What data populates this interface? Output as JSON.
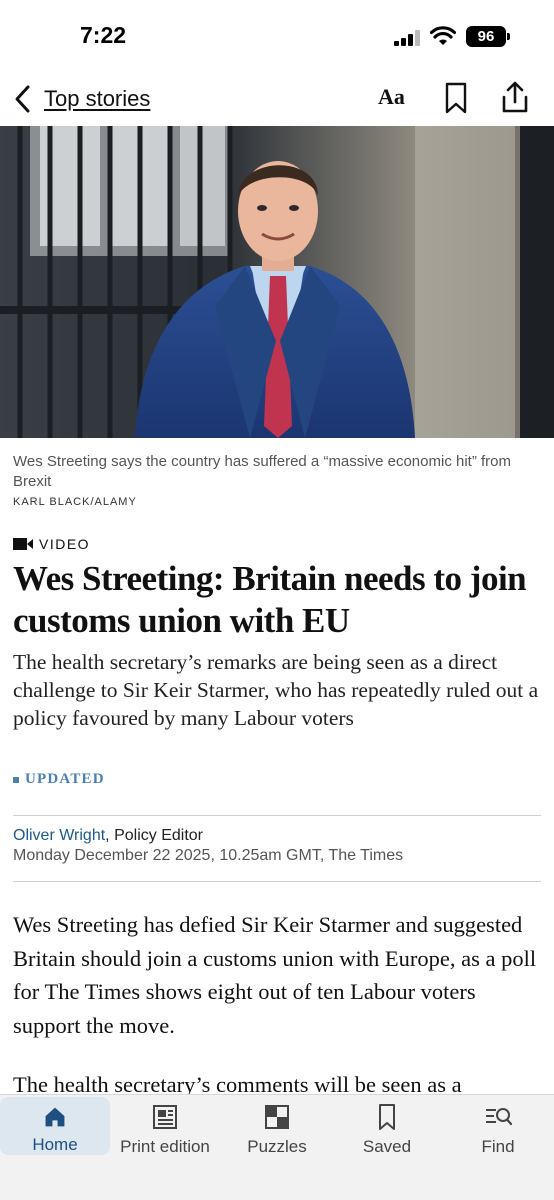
{
  "status_bar": {
    "time": "7:22",
    "battery": "96"
  },
  "nav": {
    "back_label": "Top stories",
    "text_size_label": "Aa",
    "icons": [
      "chevron-left-icon",
      "bookmark-icon",
      "share-icon"
    ]
  },
  "article": {
    "photo_caption": "Wes Streeting says the country has suffered a “massive economic hit” from Brexit",
    "photo_credit": "KARL BLACK/ALAMY",
    "media_tag": "VIDEO",
    "headline": "Wes Streeting: Britain needs to join customs union with EU",
    "standfirst": "The health secretary’s remarks are being seen as a direct challenge to Sir Keir Starmer, who has repeatedly ruled out a policy favoured by many Labour voters",
    "status": "UPDATED",
    "author": "Oliver Wright",
    "author_role": ", Policy Editor",
    "dateline": "Monday December 22 2025, 10.25am GMT, The Times",
    "paragraphs": [
      "Wes Streeting has defied Sir Keir Starmer and suggested Britain should join a customs union with Europe, as a poll for The Times shows eight out of ten Labour voters support the move.",
      "The health secretary’s comments will be seen as a"
    ]
  },
  "tabs": [
    {
      "label": "Home",
      "icon": "home-icon",
      "active": true
    },
    {
      "label": "Print edition",
      "icon": "newspaper-icon",
      "active": false
    },
    {
      "label": "Puzzles",
      "icon": "puzzle-grid-icon",
      "active": false
    },
    {
      "label": "Saved",
      "icon": "bookmark-icon",
      "active": false
    },
    {
      "label": "Find",
      "icon": "search-list-icon",
      "active": false
    }
  ],
  "colors": {
    "link_blue": "#1d5a8a",
    "updated_blue": "#4a7fb5",
    "active_tab_bg": "#dde7ef"
  }
}
